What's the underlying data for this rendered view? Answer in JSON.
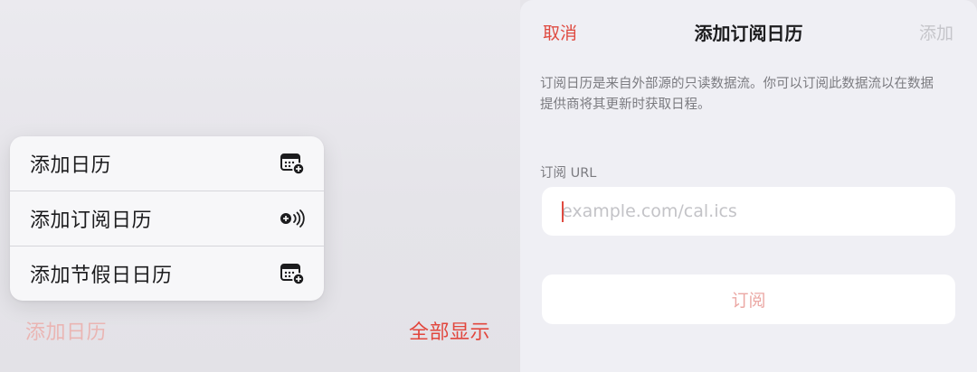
{
  "left_panel": {
    "menu": {
      "items": [
        {
          "label": "添加日历",
          "icon": "calendar-add-icon"
        },
        {
          "label": "添加订阅日历",
          "icon": "broadcast-add-icon"
        },
        {
          "label": "添加节假日日历",
          "icon": "calendar-add-icon"
        }
      ]
    },
    "add_calendar_label": "添加日历",
    "show_all_label": "全部显示"
  },
  "right_sheet": {
    "cancel_label": "取消",
    "title": "添加订阅日历",
    "add_label": "添加",
    "description": "订阅日历是来自外部源的只读数据流。你可以订阅此数据流以在数据提供商将其更新时获取日程。",
    "url_section_label": "订阅 URL",
    "url_input": {
      "value": "",
      "placeholder": "example.com/cal.ics"
    },
    "subscribe_label": "订阅"
  },
  "colors": {
    "accent": "#e2463d",
    "accent_disabled": "#eab5b3",
    "disabled_gray": "#c5c5ca"
  }
}
